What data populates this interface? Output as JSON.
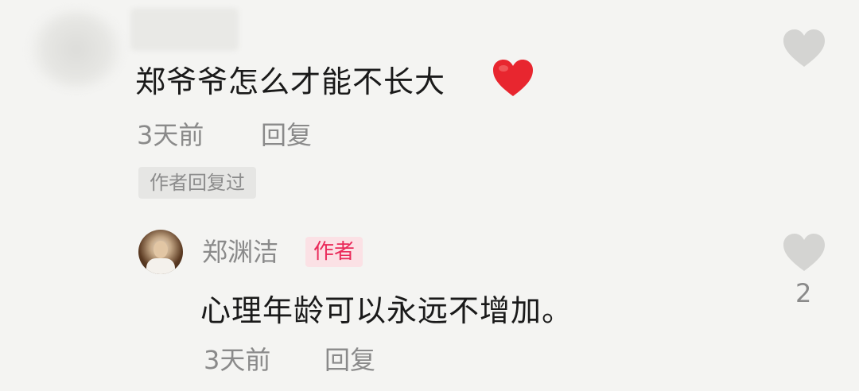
{
  "comment1": {
    "text": "郑爷爷怎么才能不长大",
    "time": "3天前",
    "reply_label": "回复",
    "author_replied_tag": "作者回复过",
    "heart_emoji_color": "#e8262f"
  },
  "reply": {
    "author_name": "郑渊洁",
    "author_badge": "作者",
    "text": "心理年龄可以永远不增加。",
    "time": "3天前",
    "reply_label": "回复",
    "like_count": "2"
  },
  "colors": {
    "background": "#f4f4f2",
    "text": "#1a1a1a",
    "meta": "#8a8a8a",
    "badge_text": "#ea2a5a",
    "badge_bg": "#fbe1e5",
    "like_icon": "#d4d4d2"
  },
  "icons": {
    "like": "heart-outline-icon",
    "emoji": "red-heart-emoji"
  }
}
